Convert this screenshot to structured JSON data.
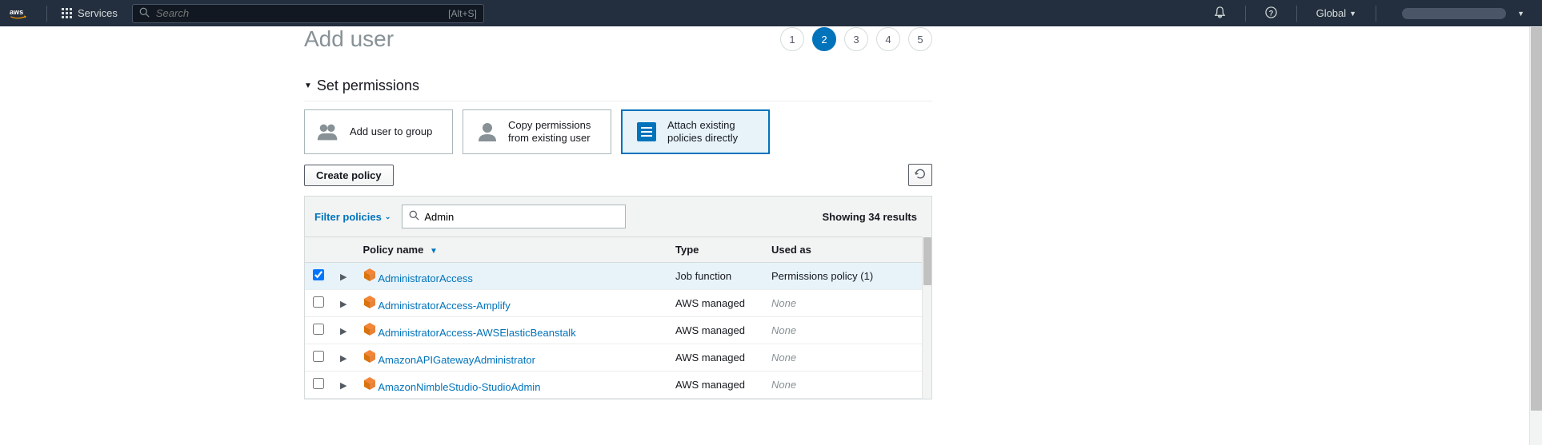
{
  "nav": {
    "services_label": "Services",
    "search_placeholder": "Search",
    "search_shortcut": "[Alt+S]",
    "region": "Global"
  },
  "page": {
    "title": "Add user",
    "steps": [
      "1",
      "2",
      "3",
      "4",
      "5"
    ],
    "active_step_index": 1
  },
  "section": {
    "title": "Set permissions"
  },
  "perm_options": [
    {
      "label": "Add user to group",
      "selected": false
    },
    {
      "label": "Copy permissions from existing user",
      "selected": false
    },
    {
      "label": "Attach existing policies directly",
      "selected": true
    }
  ],
  "buttons": {
    "create_policy": "Create policy"
  },
  "filter": {
    "label": "Filter policies",
    "search_value": "Admin",
    "results_text": "Showing 34 results"
  },
  "table": {
    "columns": {
      "name": "Policy name",
      "type": "Type",
      "used": "Used as"
    },
    "rows": [
      {
        "checked": true,
        "name": "AdministratorAccess",
        "type": "Job function",
        "used": "Permissions policy (1)",
        "used_none": false
      },
      {
        "checked": false,
        "name": "AdministratorAccess-Amplify",
        "type": "AWS managed",
        "used": "None",
        "used_none": true
      },
      {
        "checked": false,
        "name": "AdministratorAccess-AWSElasticBeanstalk",
        "type": "AWS managed",
        "used": "None",
        "used_none": true
      },
      {
        "checked": false,
        "name": "AmazonAPIGatewayAdministrator",
        "type": "AWS managed",
        "used": "None",
        "used_none": true
      },
      {
        "checked": false,
        "name": "AmazonNimbleStudio-StudioAdmin",
        "type": "AWS managed",
        "used": "None",
        "used_none": true
      }
    ]
  }
}
